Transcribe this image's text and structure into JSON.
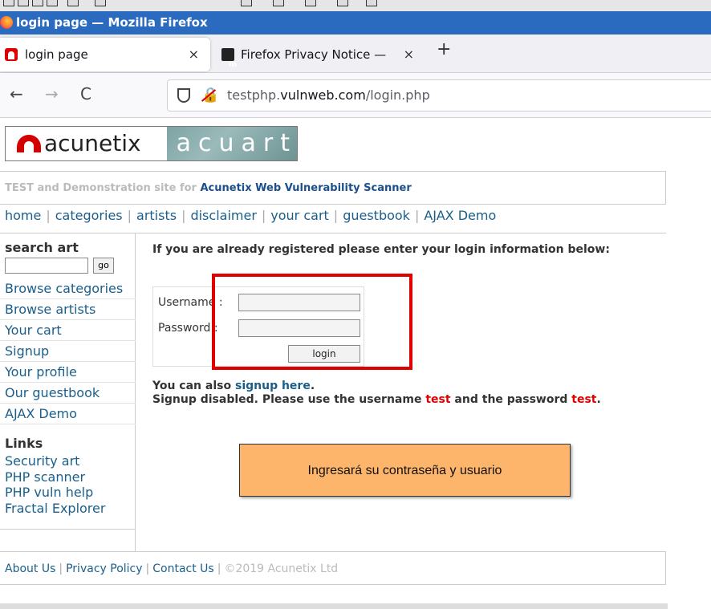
{
  "window": {
    "title": "login page — Mozilla Firefox"
  },
  "tabs": [
    {
      "label": "login page",
      "close": "×"
    },
    {
      "label": "Firefox Privacy Notice — ",
      "close": "×"
    }
  ],
  "new_tab": "+",
  "nav": {
    "back": "←",
    "forward": "→",
    "reload": "C"
  },
  "url": {
    "prefix": "testphp.",
    "host": "vulnweb.com",
    "path": "/login.php"
  },
  "logo": {
    "brand": "acunetix",
    "product": "acuart"
  },
  "tagline": {
    "prefix": "TEST and Demonstration site for ",
    "strong": "Acunetix Web Vulnerability Scanner"
  },
  "menu": [
    "home",
    "categories",
    "artists",
    "disclaimer",
    "your cart",
    "guestbook",
    "AJAX Demo"
  ],
  "sidebar": {
    "search_heading": "search art",
    "go_label": "go",
    "items": [
      "Browse categories",
      "Browse artists",
      "Your cart",
      "Signup",
      "Your profile",
      "Our guestbook",
      "AJAX Demo"
    ],
    "links_heading": "Links",
    "links": [
      "Security art",
      "PHP scanner",
      "PHP vuln help",
      "Fractal Explorer"
    ]
  },
  "login": {
    "intro": "If you are already registered please enter your login information below:",
    "username_label": "Username :",
    "password_label": "Password :",
    "button": "login"
  },
  "after": {
    "line1_prefix": "You can also ",
    "line1_link": "signup here",
    "line1_suffix": ".",
    "line2_prefix": "Signup disabled. Please use the username ",
    "username": "test",
    "line2_mid": " and the password ",
    "password": "test",
    "line2_suffix": "."
  },
  "callout": "Ingresará su contraseña y usuario",
  "footer": {
    "about": "About Us",
    "privacy": "Privacy Policy",
    "contact": "Contact Us",
    "copyright": "©2019 Acunetix Ltd"
  },
  "colors": {
    "titlebar": "#2a6bbf",
    "link": "#1a5f8b",
    "highlight": "#e00000",
    "callout": "#fdb46b"
  }
}
